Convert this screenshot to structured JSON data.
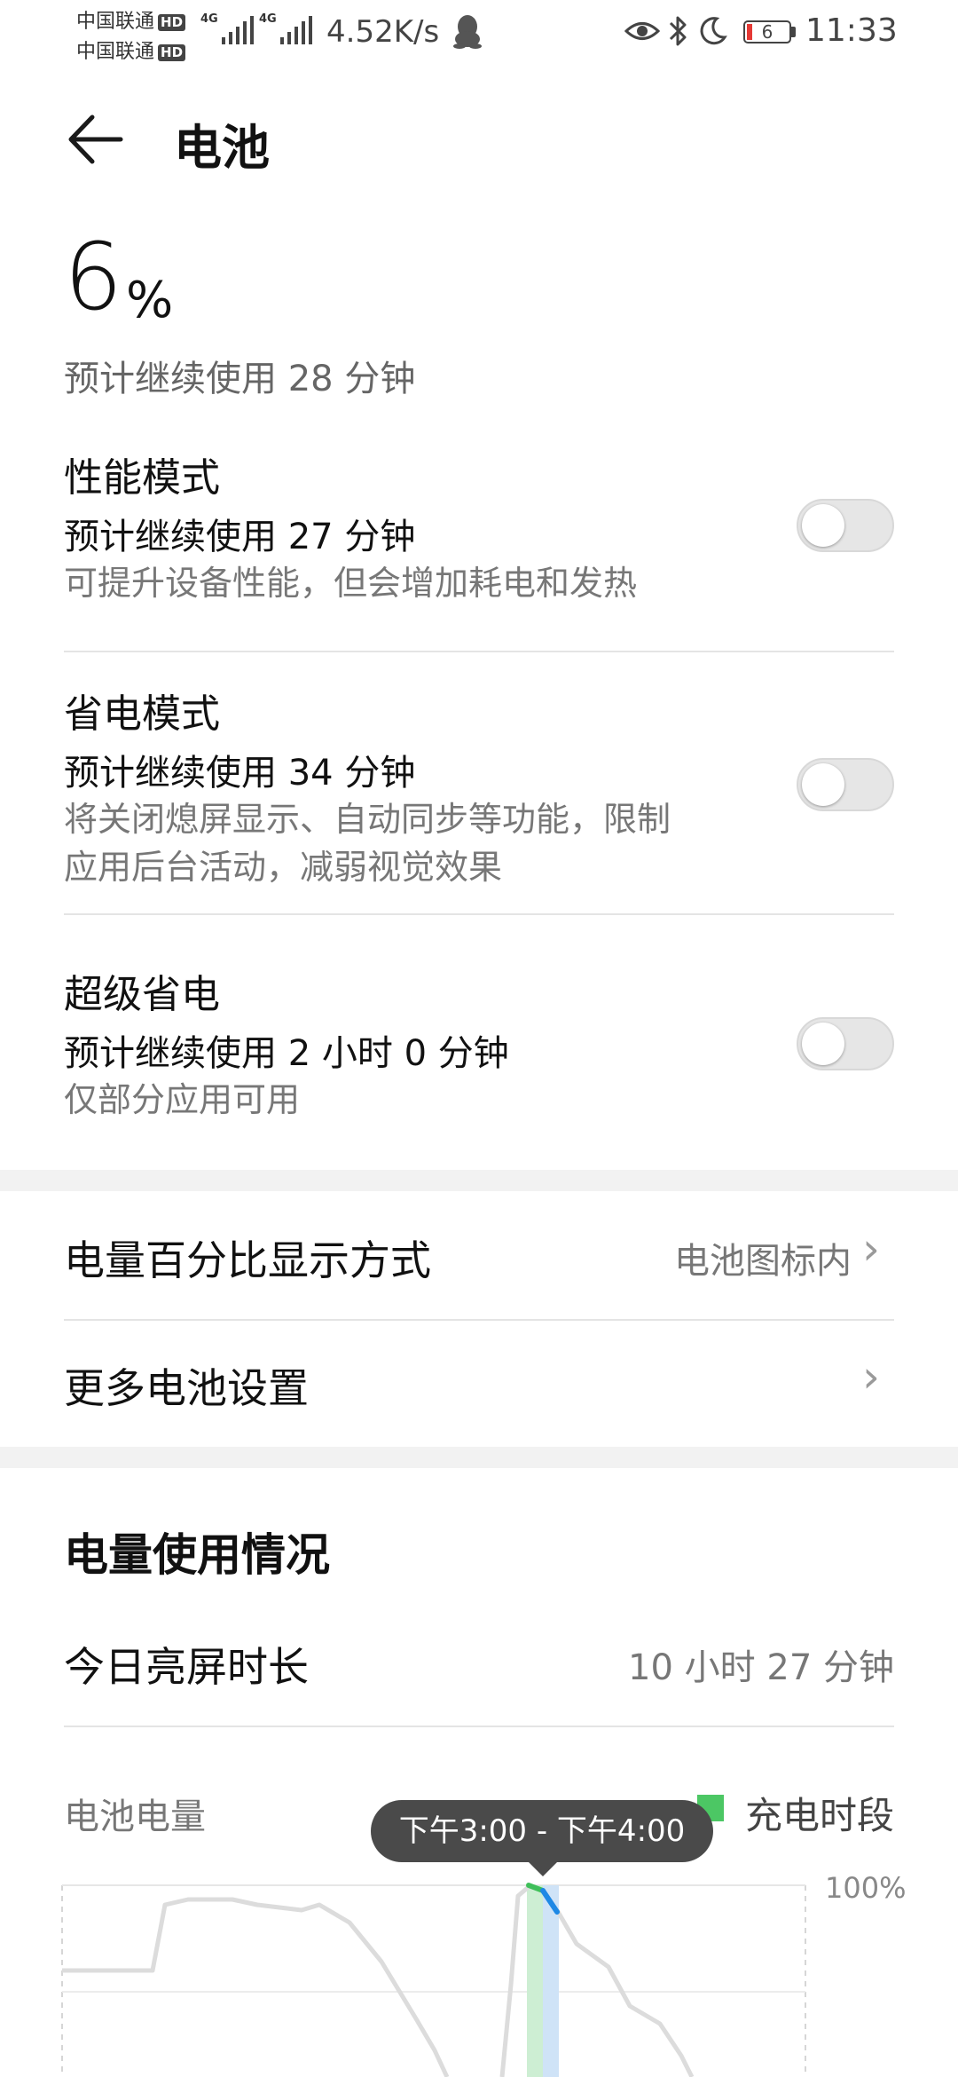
{
  "status_bar": {
    "carrier_1": "中国联通",
    "carrier_2": "中国联通",
    "hd": "HD",
    "net": "4G",
    "speed": "4.52K/s",
    "battery_level": "6",
    "time": "11:33",
    "icons": [
      "qq-icon",
      "eye-icon",
      "bluetooth-icon",
      "moon-icon",
      "battery-icon"
    ]
  },
  "header": {
    "title": "电池"
  },
  "battery": {
    "percent": "6",
    "percent_sign": "%",
    "remaining": "预计继续使用 28 分钟"
  },
  "modes": [
    {
      "title": "性能模式",
      "estimate": "预计继续使用 27 分钟",
      "desc": "可提升设备性能，但会增加耗电和发热",
      "enabled": false
    },
    {
      "title": "省电模式",
      "estimate": "预计继续使用 34 分钟",
      "desc_line1": "将关闭熄屏显示、自动同步等功能，限制",
      "desc_line2": "应用后台活动，减弱视觉效果",
      "enabled": false
    },
    {
      "title": "超级省电",
      "estimate": "预计继续使用 2 小时 0 分钟",
      "desc": "仅部分应用可用",
      "enabled": false
    }
  ],
  "settings": {
    "percent_display_label": "电量百分比显示方式",
    "percent_display_value": "电池图标内",
    "more_label": "更多电池设置"
  },
  "usage": {
    "title": "电量使用情况",
    "screen_time_label": "今日亮屏时长",
    "screen_time_value": "10 小时 27 分钟",
    "chart_label": "电池电量",
    "legend_label": "充电时段",
    "tooltip": "下午3:00 - 下午4:00",
    "axis_top": "100%"
  },
  "colors": {
    "charging": "#4cc764",
    "selected": "#1e88e5",
    "curve": "#dcdcdc"
  }
}
